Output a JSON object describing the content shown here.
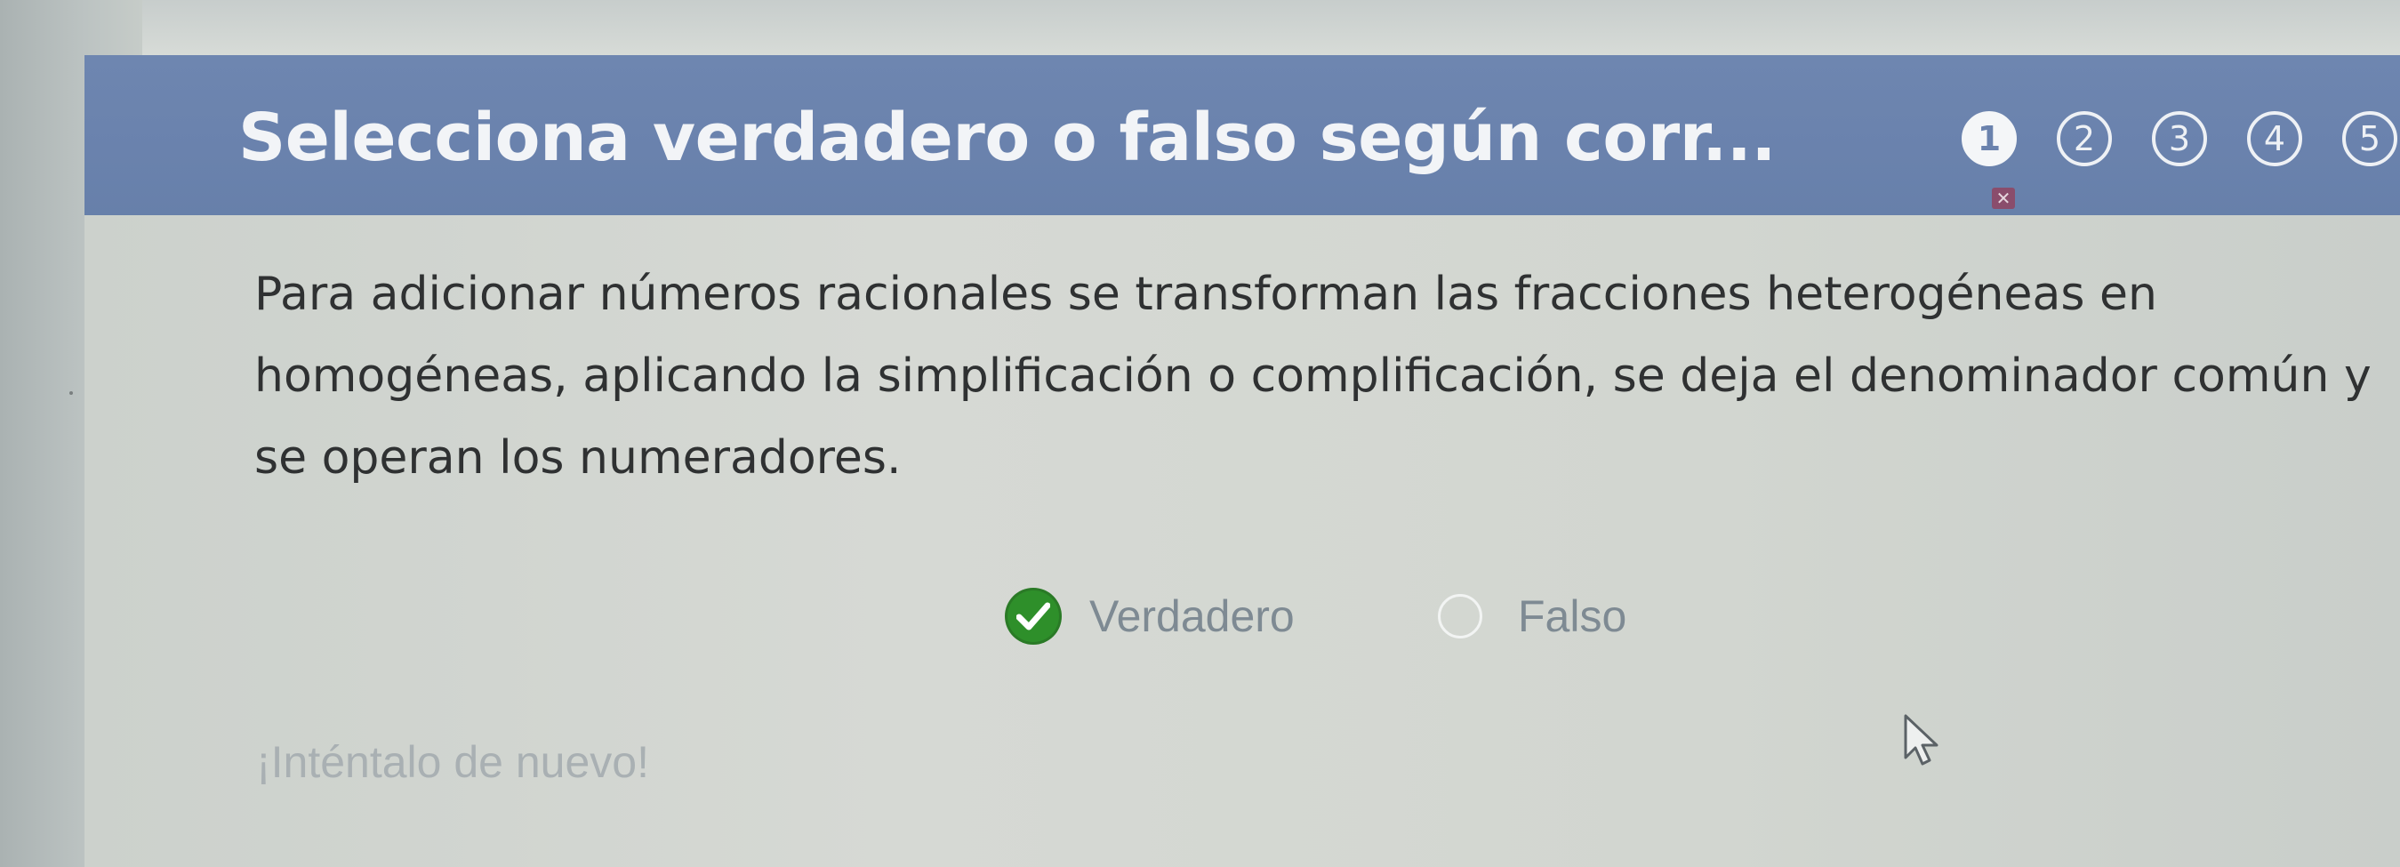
{
  "header": {
    "title": "Selecciona verdadero o falso según corr...",
    "steps": [
      {
        "label": "1",
        "state": "active"
      },
      {
        "label": "2",
        "state": "inactive"
      },
      {
        "label": "3",
        "state": "inactive"
      },
      {
        "label": "4",
        "state": "inactive"
      },
      {
        "label": "5",
        "state": "inactive"
      }
    ],
    "bar_color": "#6a82ad"
  },
  "question": {
    "text": "Para adicionar números racionales se transforman las fracciones heterogéneas en homogéneas, aplicando la simplificación o complificación, se deja el denominador común y se operan los numeradores."
  },
  "options": [
    {
      "label": "Verdadero",
      "selected": true,
      "status_icon": "check-icon",
      "status_color": "#2e8f2a"
    },
    {
      "label": "Falso",
      "selected": false
    }
  ],
  "feedback": {
    "text": "¡Inténtalo de nuevo!"
  }
}
